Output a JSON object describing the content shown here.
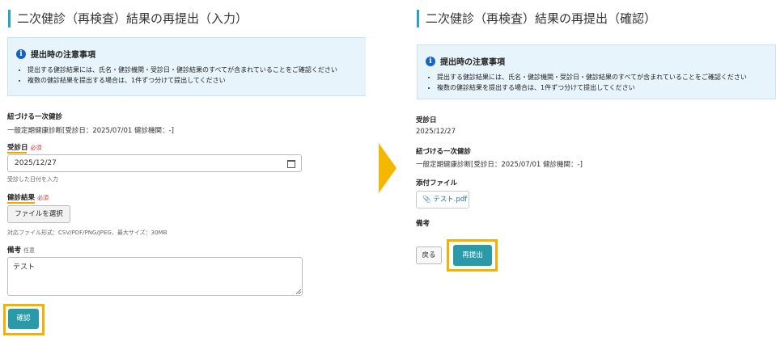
{
  "input_page": {
    "title": "二次健診（再検査）結果の再提出（入力）",
    "notice": {
      "heading": "提出時の注意事項",
      "items": [
        "提出する健診結果には、氏名・健診機関・受診日・健診結果のすべてが含まれていることをご確認ください",
        "複数の健診結果を提出する場合は、1件ずつ分けて提出してください"
      ]
    },
    "linked_label": "紐づける一次健診",
    "linked_value": "一般定期健康診断[受診日：2025/07/01 健診機関：-]",
    "exam_date_label": "受診日",
    "required": "必須",
    "exam_date_value": "2025/12/27",
    "exam_date_hint": "受診した日付を入力",
    "result_label": "健診結果",
    "file_button": "ファイルを選択",
    "file_hint": "対応ファイル形式：CSV/PDF/PNG/JPEG、最大サイズ：30MB",
    "remarks_label": "備考",
    "optional": "任意",
    "remarks_value": "テスト",
    "confirm_button": "確認"
  },
  "confirm_page": {
    "title": "二次健診（再検査）結果の再提出（確認）",
    "notice": {
      "heading": "提出時の注意事項",
      "items": [
        "提出する健診結果には、氏名・健診機関・受診日・健診結果のすべてが含まれていることをご確認ください",
        "複数の健診結果を提出する場合は、1件ずつ分けて提出してください"
      ]
    },
    "exam_date_label": "受診日",
    "exam_date_value": "2025/12/27",
    "linked_label": "紐づける一次健診",
    "linked_value": "一般定期健康診断[受診日：2025/07/01 健診機関：-]",
    "attachment_label": "添付ファイル",
    "attachment_name": "テスト.pdf",
    "remarks_label": "備考",
    "back_button": "戻る",
    "resubmit_button": "再提出"
  },
  "colors": {
    "accent": "#29a3c4",
    "primary_button": "#2a9aa8",
    "highlight": "#f0b400",
    "notice_bg": "#e8f4fb",
    "required": "#d32f2f",
    "link": "#1e6fb8"
  },
  "icons": [
    "info-icon",
    "calendar-icon",
    "resize-handle-icon",
    "paperclip-icon",
    "next-step-arrow-icon"
  ]
}
